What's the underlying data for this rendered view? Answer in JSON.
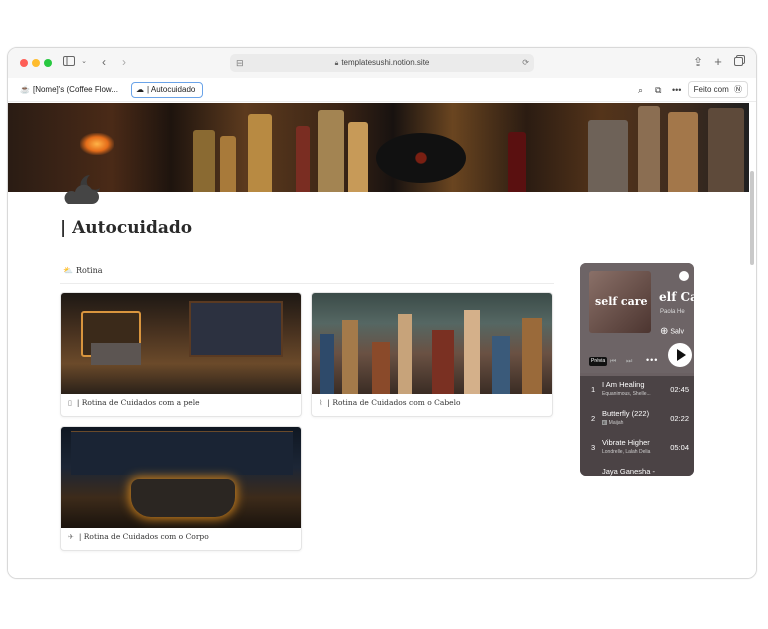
{
  "browser": {
    "url": "templatesushi.notion.site",
    "tabs": [
      {
        "label": "[Nome]'s (Coffee Flow..."
      },
      {
        "label": "| Autocuidado"
      }
    ],
    "done_button": "Feito com"
  },
  "page": {
    "title": "| Autocuidado",
    "view_tab": "Rotina"
  },
  "cards": [
    {
      "label": "| Rotina de Cuidados com a pele"
    },
    {
      "label": "| Rotina de Cuidados com o Cabelo"
    },
    {
      "label": "| Rotina de Cuidados com o Corpo"
    }
  ],
  "spotify": {
    "art_text": "self care",
    "title": "elf Ca",
    "artist": "Paola He",
    "save_label": "Salv",
    "preview_label": "Prévia",
    "tracks": [
      {
        "num": "1",
        "name": "I Am Healing",
        "artists": "Equanimous, Shelle...",
        "duration": "02:45"
      },
      {
        "num": "2",
        "name": "Butterfly (222)",
        "artists": "Maijah",
        "duration": "02:22"
      },
      {
        "num": "3",
        "name": "Vibrate Higher",
        "artists": "Londrelle, Lalah Delia",
        "duration": "05:04"
      },
      {
        "num": "",
        "name": "Jaya Ganesha -",
        "artists": "",
        "duration": ""
      }
    ]
  },
  "colors": {
    "tab_highlight": "#6aa3e8",
    "spotify_bg": "#6a6062",
    "spotify_list_bg": "#4b4345"
  }
}
